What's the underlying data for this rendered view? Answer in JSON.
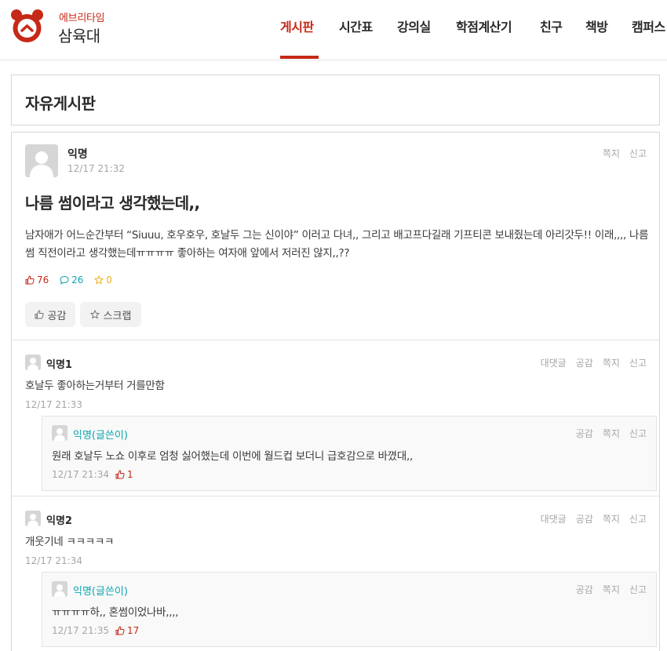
{
  "brand": {
    "sub": "에브리타임",
    "main": "삼육대"
  },
  "nav": [
    "게시판",
    "시간표",
    "강의실",
    "학점계산기",
    "친구",
    "책방",
    "캠퍼스"
  ],
  "board_title": "자유게시판",
  "post": {
    "author": "익명",
    "time": "12/17 21:32",
    "actions": [
      "쪽지",
      "신고"
    ],
    "title": "나름 썸이라고 생각했는데,,",
    "body": "남자애가 어느순간부터 “Siuuu, 호우호우, 호날두 그는 신이야” 이러고 다녀,, 그리고 배고프다길래 기프티콘 보내줬는데 아리갓두!! 이래,,,, 나름 썸 직전이라고 생각했는데ㅠㅠㅠㅠ 좋아하는 여자애 앞에서 저러진 않지,,??",
    "votes": "76",
    "comments": "26",
    "scraps": "0",
    "like_button": "공감",
    "scrap_button": "스크랩"
  },
  "comments": [
    {
      "author": "익명1",
      "text": "호날두 좋아하는거부터 거를만함",
      "time": "12/17 21:33",
      "actions": [
        "대댓글",
        "공감",
        "쪽지",
        "신고"
      ],
      "reply": {
        "author": "익명(글쓴이)",
        "text": "원래 호날두 노쇼 이후로 엄청 싫어했는데 이번에 월드컵 보더니 급호감으로 바꼈대,,",
        "time": "12/17 21:34",
        "votes": "1",
        "actions": [
          "공감",
          "쪽지",
          "신고"
        ]
      }
    },
    {
      "author": "익명2",
      "text": "개웃기네 ㅋㅋㅋㅋㅋ",
      "time": "12/17 21:34",
      "actions": [
        "대댓글",
        "공감",
        "쪽지",
        "신고"
      ],
      "reply": {
        "author": "익명(글쓴이)",
        "text": "ㅠㅠㅠㅠ하,, 혼썸이었나바,,,,",
        "time": "12/17 21:35",
        "votes": "17",
        "actions": [
          "공감",
          "쪽지",
          "신고"
        ]
      }
    }
  ],
  "colors": {
    "accent": "#c62917",
    "comment": "#0ca5af",
    "scrap": "#f2b01e",
    "muted": "#a6a6a6"
  },
  "icons": [
    "alarm-clock-logo",
    "thumbs-up-icon",
    "comment-bubble-icon",
    "star-icon",
    "avatar-icon"
  ]
}
